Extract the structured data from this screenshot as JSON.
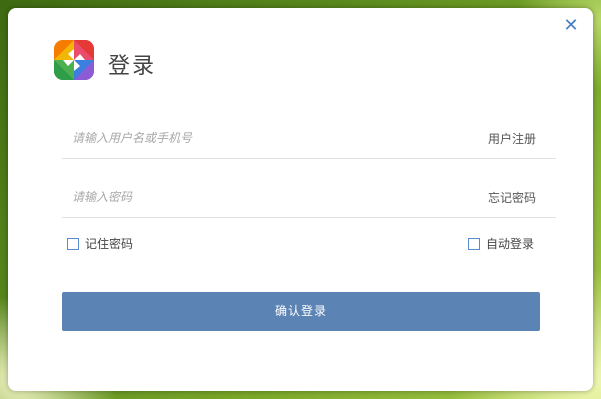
{
  "dialog": {
    "title": "登录",
    "close_icon": "close-icon",
    "logo_icon": "pinwheel-logo-icon"
  },
  "username": {
    "placeholder": "请输入用户名或手机号",
    "value": "",
    "link_label": "用户注册"
  },
  "password": {
    "placeholder": "请输入密码",
    "value": "",
    "link_label": "忘记密码"
  },
  "options": {
    "remember_label": "记住密码",
    "remember_checked": false,
    "auto_login_label": "自动登录",
    "auto_login_checked": false
  },
  "submit": {
    "label": "确认登录"
  },
  "colors": {
    "accent": "#5b83b3",
    "close": "#4a7fc0",
    "checkbox_border": "#5a8ad0"
  }
}
